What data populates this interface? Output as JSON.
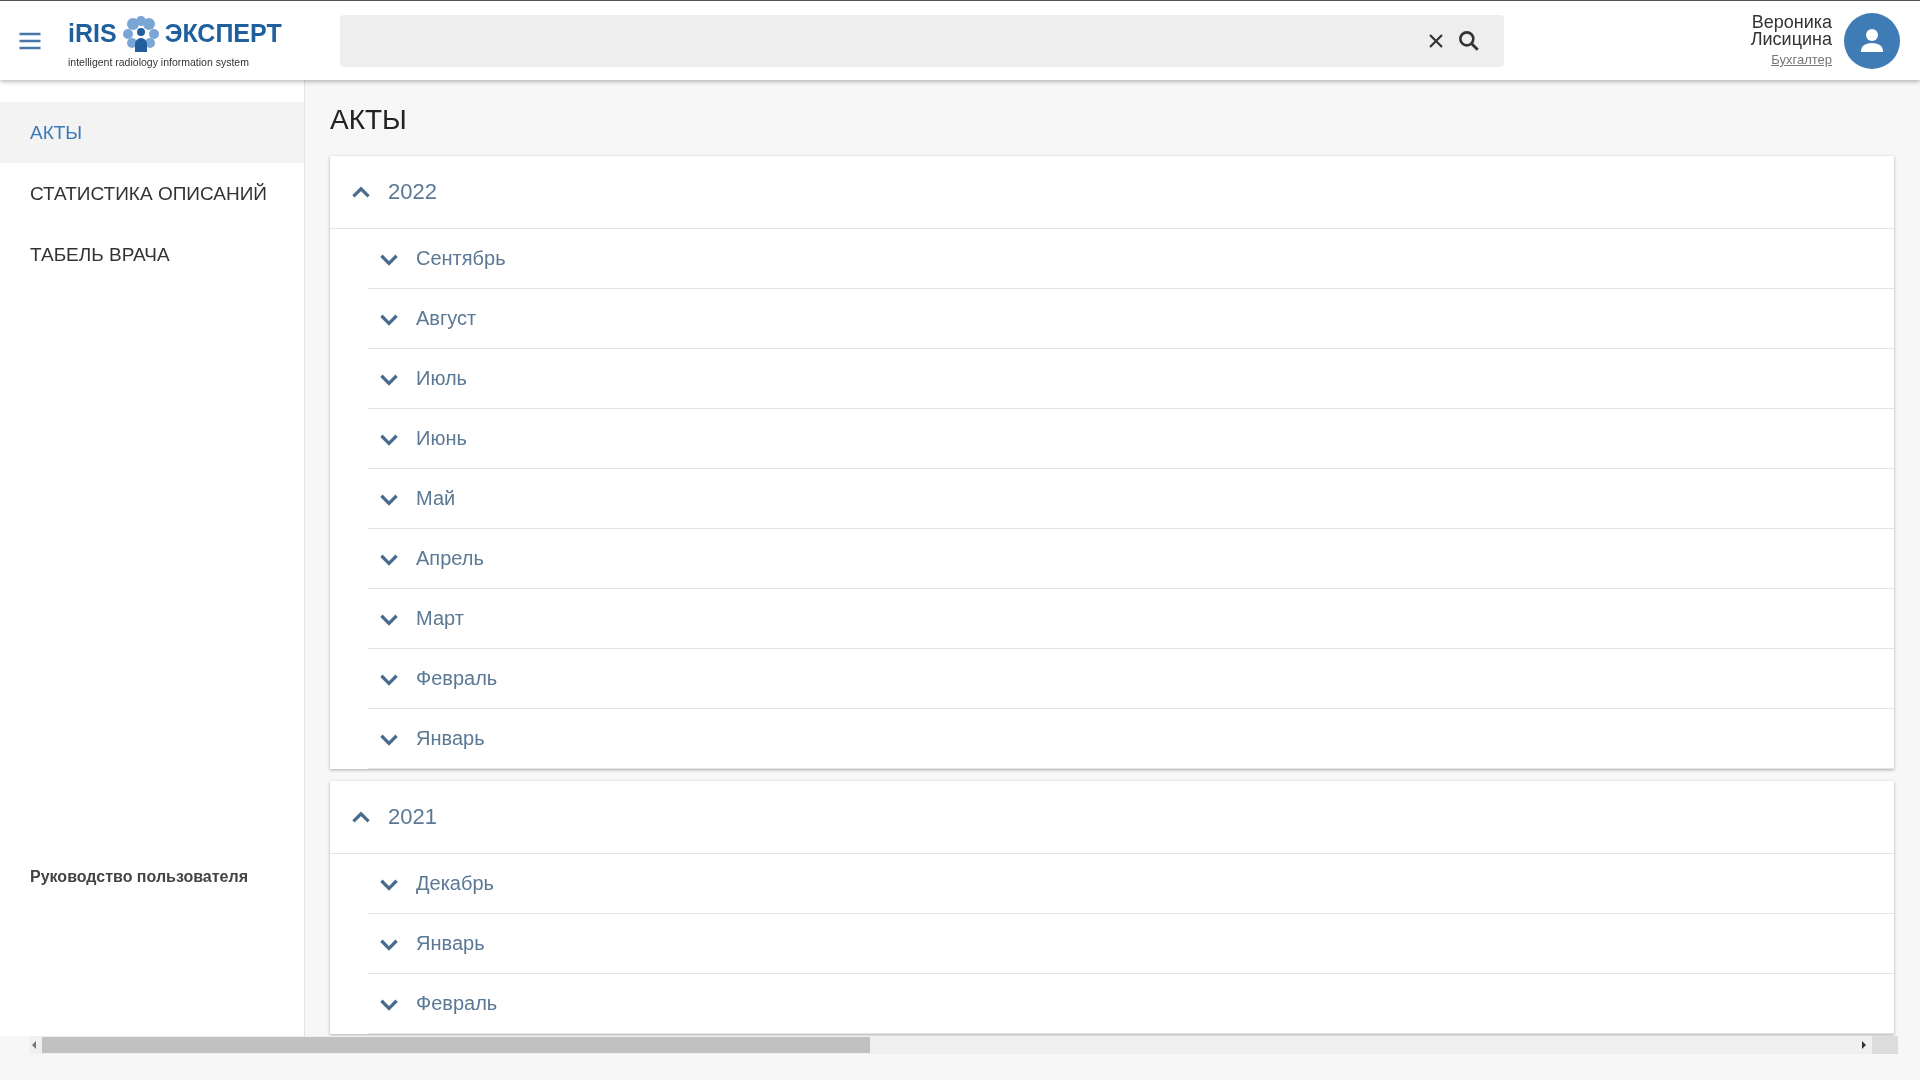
{
  "header": {
    "logo": {
      "brand_left": "iRIS",
      "brand_right": "ЭКСПЕРТ",
      "tagline": "intelligent radiology information system"
    },
    "user": {
      "first_name": "Вероника",
      "last_name": "Лисицина",
      "role": "Бухгалтер"
    }
  },
  "sidebar": {
    "items": [
      {
        "label": "АКТЫ",
        "selected": true
      },
      {
        "label": "СТАТИСТИКА ОПИСАНИЙ",
        "selected": false
      },
      {
        "label": "ТАБЕЛЬ ВРАЧА",
        "selected": false
      }
    ],
    "footer_link": "Руководство пользователя"
  },
  "page": {
    "title": "АКТЫ",
    "years": [
      {
        "label": "2022",
        "expanded": true,
        "months": [
          {
            "label": "Сентябрь",
            "expanded": false
          },
          {
            "label": "Август",
            "expanded": false
          },
          {
            "label": "Июль",
            "expanded": false
          },
          {
            "label": "Июнь",
            "expanded": false
          },
          {
            "label": "Май",
            "expanded": false
          },
          {
            "label": "Апрель",
            "expanded": false
          },
          {
            "label": "Март",
            "expanded": false
          },
          {
            "label": "Февраль",
            "expanded": false
          },
          {
            "label": "Январь",
            "expanded": false
          }
        ]
      },
      {
        "label": "2021",
        "expanded": true,
        "months": [
          {
            "label": "Декабрь",
            "expanded": false
          },
          {
            "label": "Январь",
            "expanded": false
          },
          {
            "label": "Февраль",
            "expanded": false
          }
        ]
      }
    ]
  }
}
